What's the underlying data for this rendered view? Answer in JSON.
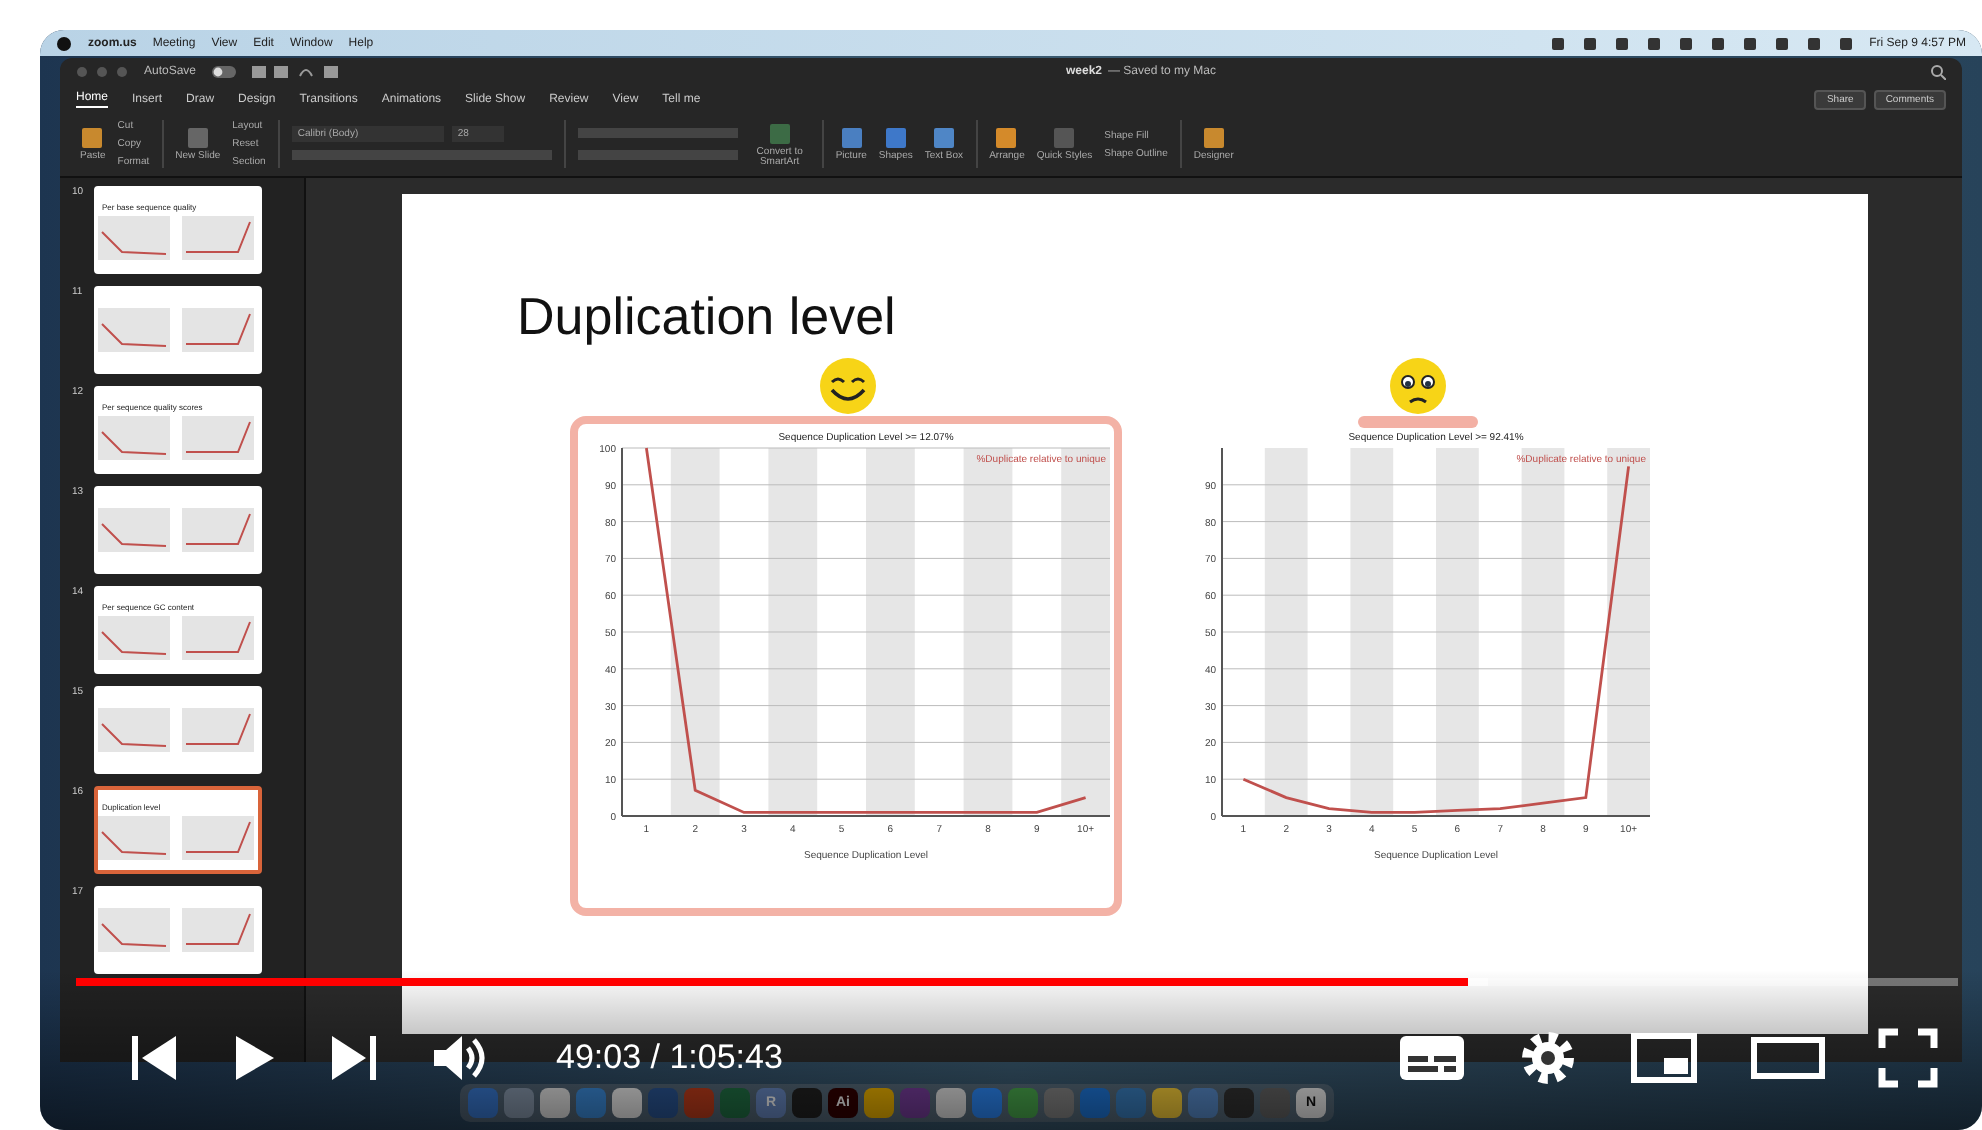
{
  "menu_bar": {
    "items": [
      "zoom.us",
      "Meeting",
      "View",
      "Edit",
      "Window",
      "Help"
    ],
    "clock": "Fri Sep 9  4:57 PM"
  },
  "title_bar": {
    "autosave": "AutoSave",
    "document": "week2",
    "status": "— Saved to my Mac"
  },
  "tabs": [
    {
      "label": "Home",
      "selected": true
    },
    {
      "label": "Insert",
      "selected": false
    },
    {
      "label": "Draw",
      "selected": false
    },
    {
      "label": "Design",
      "selected": false
    },
    {
      "label": "Transitions",
      "selected": false
    },
    {
      "label": "Animations",
      "selected": false
    },
    {
      "label": "Slide Show",
      "selected": false
    },
    {
      "label": "Review",
      "selected": false
    },
    {
      "label": "View",
      "selected": false
    },
    {
      "label": "Tell me",
      "selected": false
    }
  ],
  "share_buttons": [
    "Share",
    "Comments"
  ],
  "ribbon": {
    "paste": "Paste",
    "clipboard": [
      "Cut",
      "Copy",
      "Format"
    ],
    "new_slide": "New Slide",
    "slide_tools": [
      "Layout",
      "Reset",
      "Section"
    ],
    "font": "Calibri (Body)",
    "font_size": "28",
    "convert": "Convert to SmartArt",
    "insert": [
      "Picture",
      "Shapes",
      "Text Box"
    ],
    "arrange": "Arrange",
    "quick_styles": "Quick Styles",
    "shape_tools": [
      "Shape Fill",
      "Shape Outline"
    ],
    "designer": "Designer"
  },
  "thumbnails": [
    {
      "number": "10",
      "title": "Per base sequence quality",
      "selected": false
    },
    {
      "number": "11",
      "selected": false
    },
    {
      "number": "12",
      "title": "Per sequence quality scores",
      "selected": false
    },
    {
      "number": "13",
      "selected": false
    },
    {
      "number": "14",
      "title": "Per sequence GC content",
      "selected": false
    },
    {
      "number": "15",
      "selected": false
    },
    {
      "number": "16",
      "title": "Duplication level",
      "selected": true
    },
    {
      "number": "17",
      "selected": false
    }
  ],
  "slide": {
    "title": "Duplication level",
    "panels": [
      {
        "kind": "happy",
        "chart_data": {
          "type": "line",
          "grid": true,
          "title": "Sequence Duplication Level >= 12.07%",
          "xlabel": "Sequence Duplication Level",
          "categories": [
            "1",
            "2",
            "3",
            "4",
            "5",
            "6",
            "7",
            "8",
            "9",
            "10+"
          ],
          "series": [
            {
              "name": "%Duplicate relative to unique",
              "color": "#c0504d",
              "values": [
                100,
                7,
                1,
                1,
                1,
                1,
                1,
                1,
                1,
                5
              ]
            }
          ],
          "ylim": [
            0,
            100
          ],
          "yticks": [
            0,
            10,
            20,
            30,
            40,
            50,
            60,
            70,
            80,
            90,
            100
          ]
        }
      },
      {
        "kind": "sad",
        "chart_data": {
          "type": "line",
          "grid": true,
          "title": "Sequence Duplication Level >= 92.41%",
          "xlabel": "Sequence Duplication Level",
          "categories": [
            "1",
            "2",
            "3",
            "4",
            "5",
            "6",
            "7",
            "8",
            "9",
            "10+"
          ],
          "series": [
            {
              "name": "%Duplicate relative to unique",
              "color": "#c0504d",
              "values": [
                10,
                5,
                2,
                1,
                1,
                1.5,
                2,
                3.5,
                5,
                95
              ]
            }
          ],
          "ylim": [
            0,
            100
          ],
          "yticks": [
            0,
            10,
            20,
            30,
            40,
            50,
            60,
            70,
            80,
            90
          ]
        }
      }
    ]
  },
  "player": {
    "time": "49:03 / 1:05:43",
    "level": 0.74
  },
  "dock": [
    {
      "kind": "app"
    },
    {
      "kind": "app"
    },
    {
      "kind": "app"
    },
    {
      "kind": "app"
    },
    {
      "kind": "app"
    },
    {
      "kind": "app"
    },
    {
      "kind": "app"
    },
    {
      "kind": "app"
    },
    {
      "kind": "app",
      "label": "R"
    },
    {
      "kind": "app"
    },
    {
      "kind": "app",
      "label": "Ai"
    },
    {
      "kind": "app"
    },
    {
      "kind": "app"
    },
    {
      "kind": "app"
    },
    {
      "kind": "app"
    },
    {
      "kind": "app"
    },
    {
      "kind": "app"
    },
    {
      "kind": "app"
    },
    {
      "kind": "app"
    },
    {
      "kind": "app"
    },
    {
      "kind": "app"
    },
    {
      "kind": "app"
    },
    {
      "kind": "app"
    },
    {
      "kind": "app",
      "label": "N"
    }
  ]
}
